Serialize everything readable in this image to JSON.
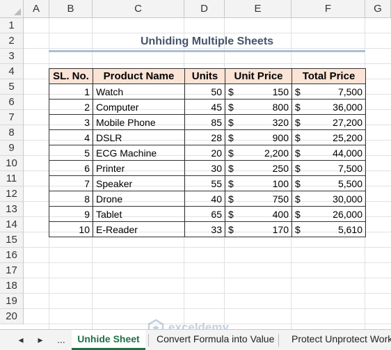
{
  "columns": [
    "A",
    "B",
    "C",
    "D",
    "E",
    "F",
    "G"
  ],
  "rows": [
    "1",
    "2",
    "3",
    "4",
    "5",
    "6",
    "7",
    "8",
    "9",
    "10",
    "11",
    "12",
    "13",
    "14",
    "15",
    "16",
    "17",
    "18",
    "19",
    "20"
  ],
  "title": "Unhiding Multiple Sheets",
  "table": {
    "headers": [
      "SL. No.",
      "Product Name",
      "Units",
      "Unit Price",
      "Total Price"
    ],
    "currency": "$",
    "rows": [
      {
        "sl": "1",
        "product": "Watch",
        "units": "50",
        "price": "150",
        "total": "7,500"
      },
      {
        "sl": "2",
        "product": "Computer",
        "units": "45",
        "price": "800",
        "total": "36,000"
      },
      {
        "sl": "3",
        "product": "Mobile Phone",
        "units": "85",
        "price": "320",
        "total": "27,200"
      },
      {
        "sl": "4",
        "product": "DSLR",
        "units": "28",
        "price": "900",
        "total": "25,200"
      },
      {
        "sl": "5",
        "product": "ECG Machine",
        "units": "20",
        "price": "2,200",
        "total": "44,000"
      },
      {
        "sl": "6",
        "product": "Printer",
        "units": "30",
        "price": "250",
        "total": "7,500"
      },
      {
        "sl": "7",
        "product": "Speaker",
        "units": "55",
        "price": "100",
        "total": "5,500"
      },
      {
        "sl": "8",
        "product": "Drone",
        "units": "40",
        "price": "750",
        "total": "30,000"
      },
      {
        "sl": "9",
        "product": "Tablet",
        "units": "65",
        "price": "400",
        "total": "26,000"
      },
      {
        "sl": "10",
        "product": "E-Reader",
        "units": "33",
        "price": "170",
        "total": "5,610"
      }
    ]
  },
  "tabs": {
    "prev": "◂",
    "next": "▸",
    "more": "...",
    "active": "Unhide Sheet",
    "second": "Convert Formula into Value",
    "third": "Protect Unprotect Works"
  },
  "watermark": {
    "name": "exceldemy",
    "tagline": "EXCEL · DATA · BI"
  },
  "colors": {
    "accent": "#1e7145",
    "header_fill": "#fbe3d6",
    "title": "#44546a"
  }
}
